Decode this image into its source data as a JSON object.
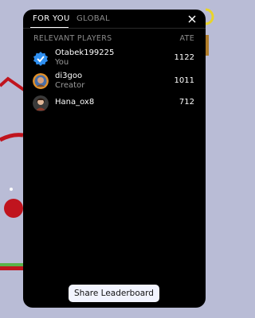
{
  "tabs": {
    "for_you": "FOR YOU",
    "global": "GLOBAL"
  },
  "columns": {
    "players": "RELEVANT PLAYERS",
    "score": "ATE"
  },
  "players": [
    {
      "name": "Otabek199225",
      "subtitle": "You",
      "score": "1122",
      "avatar": "verified-badge-icon"
    },
    {
      "name": "di3goo",
      "subtitle": "Creator",
      "score": "1011",
      "avatar": "creator-avatar"
    },
    {
      "name": "Hana_ox8",
      "subtitle": "",
      "score": "712",
      "avatar": "player-avatar"
    }
  ],
  "share_button": "Share Leaderboard",
  "colors": {
    "panel": "#000000",
    "background": "#b9bcd6",
    "accent_blue": "#2f8ff0",
    "scene_red": "#c0141e"
  }
}
